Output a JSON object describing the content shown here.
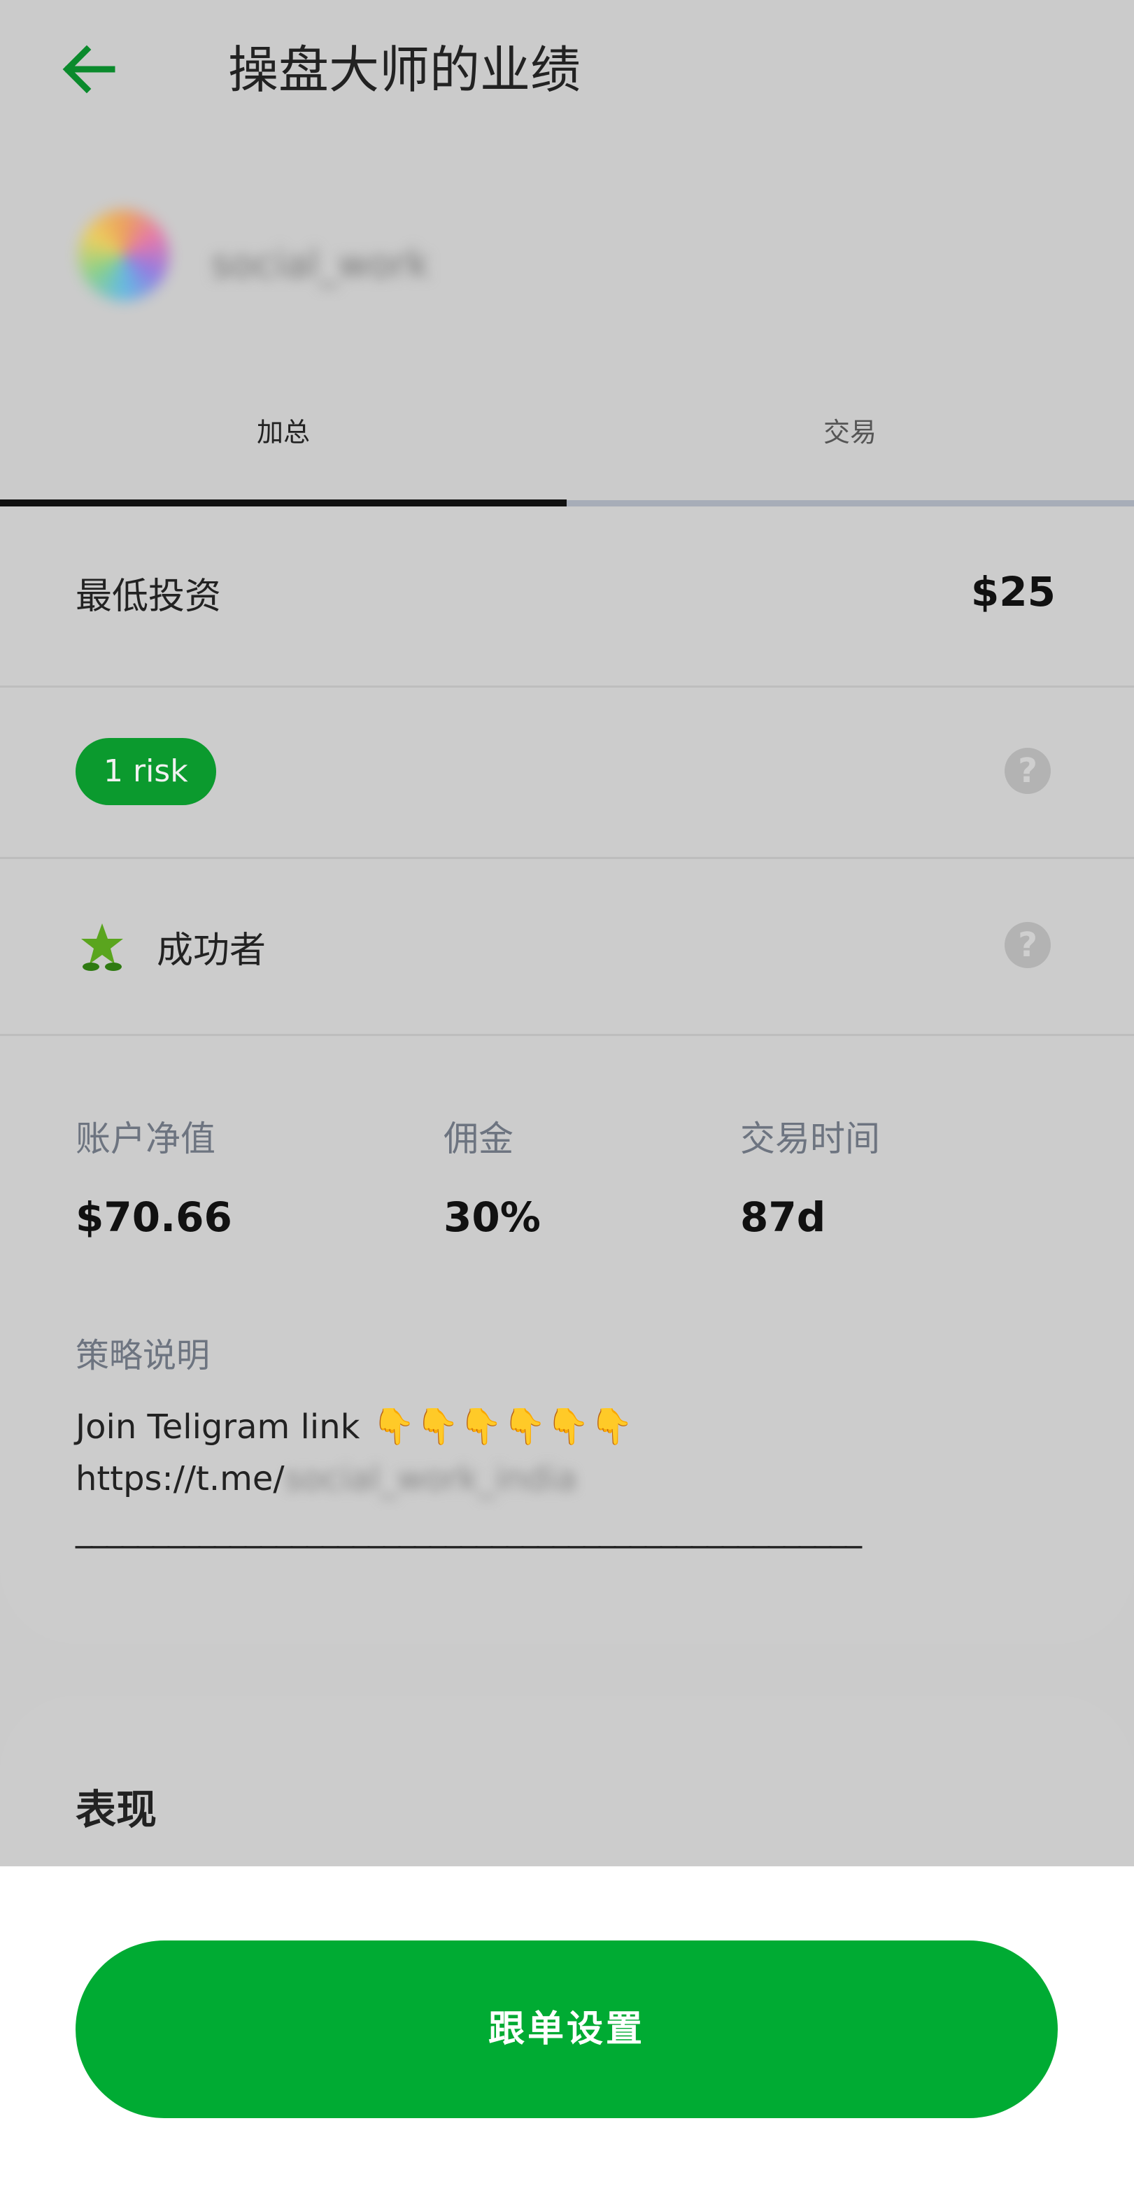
{
  "header": {
    "title": "操盘大师的业绩",
    "back_icon": "arrow-left-icon"
  },
  "profile": {
    "username": "social_work"
  },
  "tabs": [
    {
      "label": "加总",
      "active": true
    },
    {
      "label": "交易",
      "active": false
    }
  ],
  "summary": {
    "min_investment_label": "最低投资",
    "min_investment_value": "$25",
    "risk_badge": "1 risk",
    "trader_type": "成功者",
    "stats": [
      {
        "label": "账户净值",
        "value": "$70.66"
      },
      {
        "label": "佣金",
        "value": "30%"
      },
      {
        "label": "交易时间",
        "value": "87d"
      }
    ],
    "strategy_label": "策略说明",
    "strategy_line1": "Join Teligram link ",
    "strategy_hands": "👇👇👇👇👇👇",
    "strategy_line2_prefix": "https://t.me/",
    "strategy_line2_blurred": "social_work_india",
    "strategy_line3": "___________________________________________________"
  },
  "performance": {
    "title": "表现"
  },
  "footer": {
    "button_label": "跟单设置"
  },
  "colors": {
    "accent": "#00ab33",
    "badge": "#0b9a2e",
    "star": "#5aa51e"
  }
}
